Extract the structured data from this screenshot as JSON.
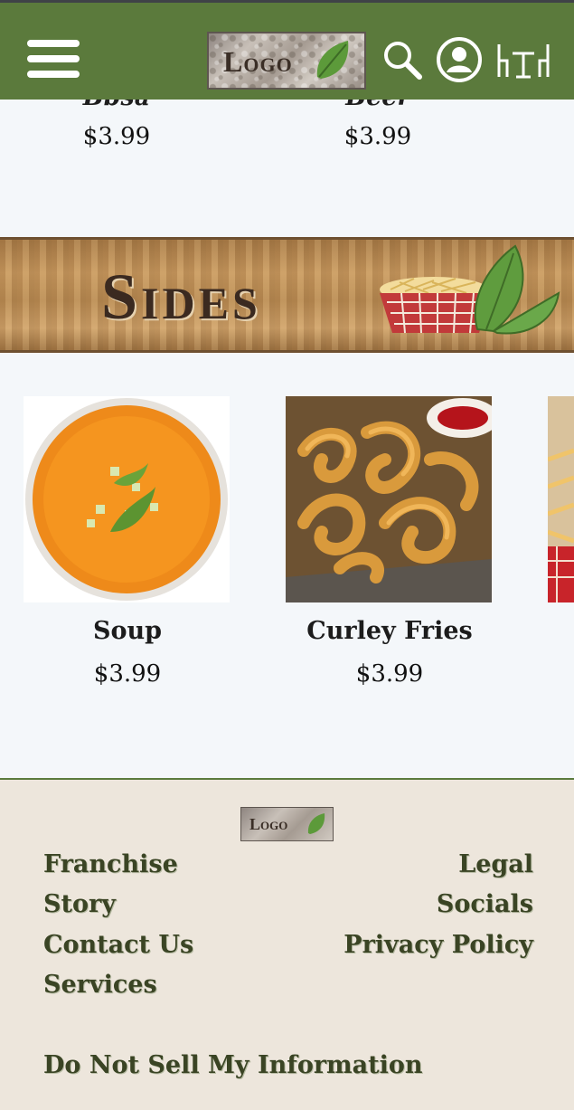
{
  "header": {
    "logo_text": "Logo",
    "icons": [
      "menu-icon",
      "search-icon",
      "user-icon",
      "table-icon"
    ]
  },
  "previous_items": [
    {
      "name": "Bbsa",
      "price": "$3.99"
    },
    {
      "name": "Beer",
      "price": "$3.99"
    }
  ],
  "section": {
    "title": "Sides"
  },
  "items": [
    {
      "name": "Soup",
      "price": "$3.99"
    },
    {
      "name": "Curley Fries",
      "price": "$3.99"
    }
  ],
  "footer": {
    "logo_text": "Logo",
    "left_links": [
      "Franchise",
      "Story",
      "Contact Us",
      "Services"
    ],
    "right_links": [
      "Legal",
      "Socials",
      "Privacy Policy"
    ],
    "bottom_link": "Do Not Sell My Information"
  },
  "colors": {
    "header_bg": "#5b7a3c",
    "page_bg": "#f4f7fa",
    "footer_bg": "#ede6dc",
    "footer_link": "#3a4424"
  }
}
